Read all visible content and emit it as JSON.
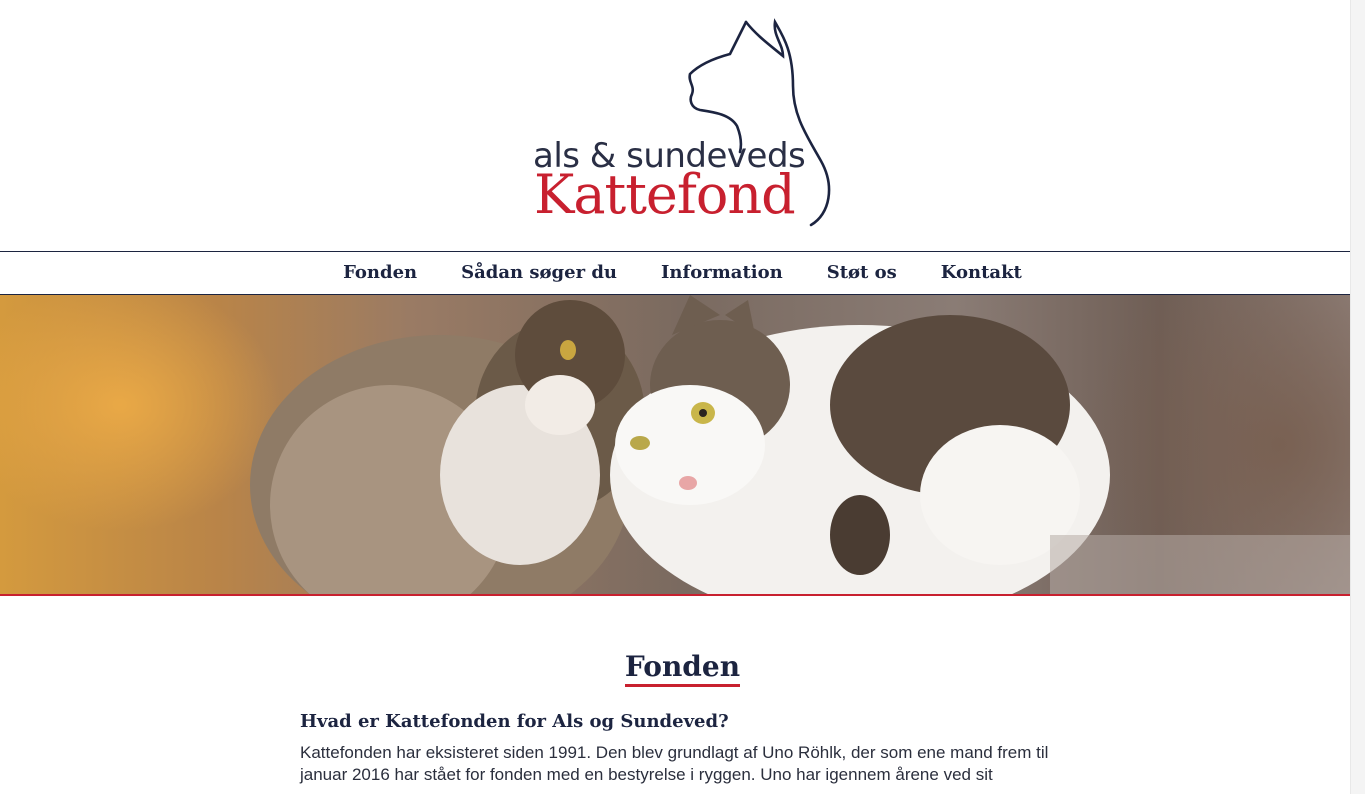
{
  "logo": {
    "line1": "als & sundeveds",
    "line2": "Kattefond",
    "colors": {
      "line1": "#2a2f45",
      "line2": "#c8202f",
      "cat_outline": "#1c2440"
    },
    "icon": "cat-silhouette-icon"
  },
  "nav": {
    "items": [
      {
        "label": "Fonden"
      },
      {
        "label": "Sådan søger du"
      },
      {
        "label": "Information"
      },
      {
        "label": "Støt os"
      },
      {
        "label": "Kontakt"
      }
    ]
  },
  "hero": {
    "image": "two-cats-photo"
  },
  "main": {
    "title": "Fonden",
    "subheading": "Hvad er Kattefonden for Als og Sundeved?",
    "paragraph": "Kattefonden har eksisteret siden 1991. Den blev grundlagt af Uno Röhlk, der som ene mand frem til januar 2016 har stået for fonden med en bestyrelse i ryggen. Uno har igennem årene ved sit"
  },
  "colors": {
    "accent": "#c8202f",
    "navy": "#1c2440"
  }
}
